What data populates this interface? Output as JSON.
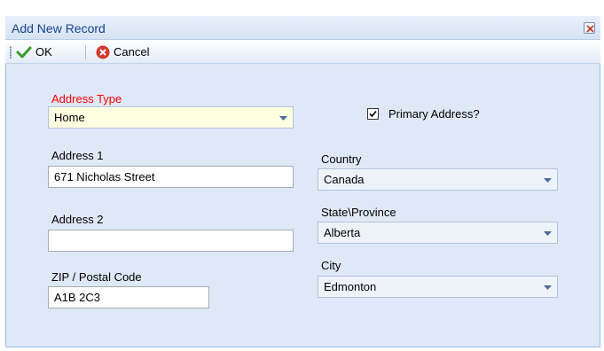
{
  "window": {
    "title": "Add New Record",
    "close_icon": "close-icon"
  },
  "toolbar": {
    "ok_label": "OK",
    "cancel_label": "Cancel"
  },
  "form": {
    "address_type": {
      "label": "Address Type",
      "value": "Home"
    },
    "primary_address": {
      "label": "Primary Address?",
      "checked": true
    },
    "address1": {
      "label": "Address 1",
      "value": "671 Nicholas Street"
    },
    "address2": {
      "label": "Address 2",
      "value": ""
    },
    "zip": {
      "label": "ZIP / Postal Code",
      "value": "A1B 2C3"
    },
    "country": {
      "label": "Country",
      "value": "Canada"
    },
    "state": {
      "label": "State\\Province",
      "value": "Alberta"
    },
    "city": {
      "label": "City",
      "value": "Edmonton"
    }
  },
  "colors": {
    "required_label": "#ff0000",
    "title_text": "#15428b",
    "highlight_field": "#ffffe1"
  }
}
